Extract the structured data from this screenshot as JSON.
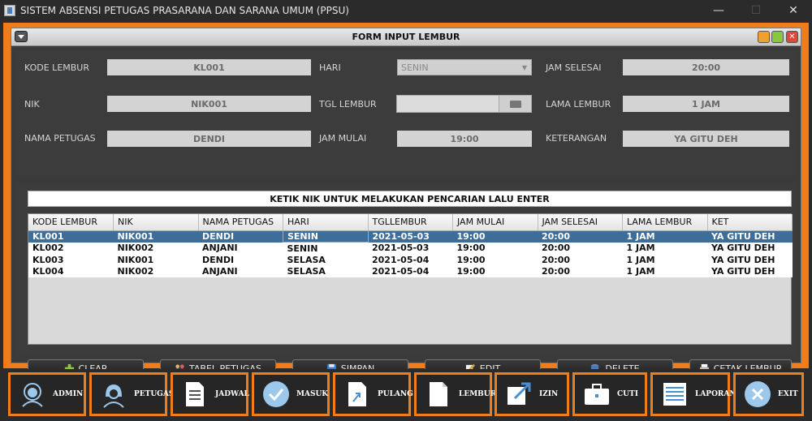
{
  "window": {
    "title": "SISTEM ABSENSI PETUGAS PRASARANA DAN SARANA UMUM (PPSU)",
    "minimize": "—",
    "maximize": "☐",
    "close": "✕"
  },
  "form": {
    "title": "FORM INPUT LEMBUR",
    "kode_lembur": {
      "label": "KODE LEMBUR",
      "value": "KL001"
    },
    "nik": {
      "label": "NIK",
      "value": "NIK001"
    },
    "nama_petugas": {
      "label": "NAMA PETUGAS",
      "value": "DENDI"
    },
    "hari": {
      "label": "HARI",
      "value": "SENIN"
    },
    "tgl_lembur": {
      "label": "TGL LEMBUR",
      "value": ""
    },
    "jam_mulai": {
      "label": "JAM MULAI",
      "value": "19:00"
    },
    "jam_selesai": {
      "label": "JAM SELESAI",
      "value": "20:00"
    },
    "lama_lembur": {
      "label": "LAMA LEMBUR",
      "value": "1 JAM"
    },
    "keterangan": {
      "label": "KETERANGAN",
      "value": "YA GITU DEH"
    }
  },
  "search": {
    "text": "KETIK NIK UNTUK MELAKUKAN PENCARIAN LALU ENTER"
  },
  "table": {
    "columns": [
      "KODE LEMBUR",
      "NIK",
      "NAMA PETUGAS",
      "HARI",
      "TGLLEMBUR",
      "JAM MULAI",
      "JAM SELESAI",
      "LAMA LEMBUR",
      "KET"
    ],
    "rows": [
      [
        "KL001",
        "NIK001",
        "DENDI",
        "SENIN",
        "2021-05-03",
        "19:00",
        "20:00",
        "1 JAM",
        "YA GITU DEH"
      ],
      [
        "KL002",
        "NIK002",
        "ANJANI",
        "SENIN",
        "2021-05-03",
        "19:00",
        "20:00",
        "1 JAM",
        "YA GITU DEH"
      ],
      [
        "KL003",
        "NIK001",
        "DENDI",
        "SELASA",
        "2021-05-04",
        "19:00",
        "20:00",
        "1 JAM",
        "YA GITU DEH"
      ],
      [
        "KL004",
        "NIK002",
        "ANJANI",
        "SELASA",
        "2021-05-04",
        "19:00",
        "20:00",
        "1 JAM",
        "YA GITU DEH"
      ]
    ],
    "selected_row": 0
  },
  "buttons": {
    "clear": "CLEAR",
    "tabel_petugas": "TABEL PETUGAS",
    "simpan": "SIMPAN",
    "edit": "EDIT",
    "delete": "DELETE",
    "cetak": "CETAK LEMBUR"
  },
  "nav": {
    "admin": "ADMIN",
    "petugas": "PETUGAS",
    "jadwal": "JADWAL",
    "masuk": "MASUK",
    "pulang": "PULANG",
    "lembur": "LEMBUR",
    "izin": "IZIN",
    "cuti": "CUTI",
    "laporan": "LAPORAN",
    "exit": "EXIT"
  },
  "colors": {
    "accent": "#f07d1a",
    "selection": "#3d6e99",
    "background": "#2b2b2b"
  }
}
